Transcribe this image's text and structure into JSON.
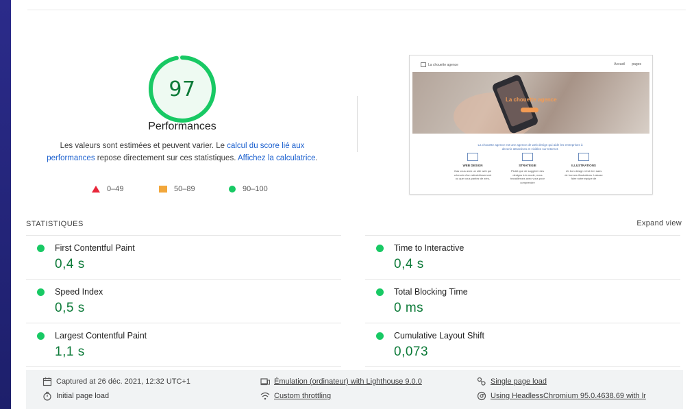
{
  "score": {
    "value": "97",
    "title": "Performances",
    "desc_prefix": "Les valeurs sont estimées et peuvent varier. Le ",
    "desc_link1": "calcul du score lié aux performances",
    "desc_mid": " repose directement sur ces statistiques. ",
    "desc_link2": "Affichez la calculatrice",
    "desc_suffix": ".",
    "gauge_fraction": 0.97,
    "color": "#18c964"
  },
  "legend": {
    "fail": "0–49",
    "average": "50–89",
    "pass": "90–100"
  },
  "thumbnail": {
    "logo_text": "La chouette agence",
    "nav_links": [
      "Accueil",
      "pages"
    ],
    "hero_title": "La chouette agence",
    "intro": "La chouette agence est une agence de web design qui aide les entreprises à devenir attractives et visibles sur Internet.",
    "columns": [
      {
        "title": "WEB DESIGN",
        "text": "Gas vous avez un site web qui a besoin d'un rafraîchissement ou que vous partiez de zéro,"
      },
      {
        "title": "STRATÉGIE",
        "text": "Plutôt que de suggérer des designs à la mode, nous travaillerons avec vous pour comprendre"
      },
      {
        "title": "ILLUSTRATIONS",
        "text": "Un bon design n'est rien sans de bonnes illustrations. Laissez faire notre équipe de"
      }
    ]
  },
  "stats": {
    "header": "STATISTIQUES",
    "expand": "Expand view",
    "metrics": [
      {
        "label": "First Contentful Paint",
        "value": "0,4 s"
      },
      {
        "label": "Time to Interactive",
        "value": "0,4 s"
      },
      {
        "label": "Speed Index",
        "value": "0,5 s"
      },
      {
        "label": "Total Blocking Time",
        "value": "0 ms"
      },
      {
        "label": "Largest Contentful Paint",
        "value": "1,1 s"
      },
      {
        "label": "Cumulative Layout Shift",
        "value": "0,073"
      }
    ]
  },
  "footer": {
    "captured": "Captured at 26 déc. 2021, 12:32 UTC+1",
    "emulation": "Émulation (ordinateur) with Lighthouse 9.0.0",
    "single_page": "Single page load",
    "initial_load": "Initial page load",
    "throttling": "Custom throttling",
    "using": "Using HeadlessChromium 95.0.4638.69 with lr",
    "icons": [
      "calendar-icon",
      "devices-icon",
      "single-page-icon",
      "timer-icon",
      "network-icon",
      "browser-icon"
    ]
  }
}
